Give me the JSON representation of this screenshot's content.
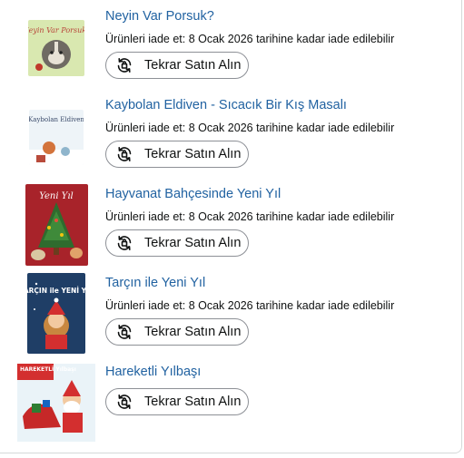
{
  "items": [
    {
      "title": "Neyin Var Porsuk?",
      "return_text": "Ürünleri iade et: 8 Ocak 2026 tarihine kadar iade edilebilir",
      "button_label": "Tekrar Satın Alın",
      "cover_text": "Neyin Var Porsuk?"
    },
    {
      "title": "Kaybolan Eldiven - Sıcacık Bir Kış Masalı",
      "return_text": "Ürünleri iade et: 8 Ocak 2026 tarihine kadar iade edilebilir",
      "button_label": "Tekrar Satın Alın",
      "cover_text": "Kaybolan Eldiven"
    },
    {
      "title": "Hayvanat Bahçesinde Yeni Yıl",
      "return_text": "Ürünleri iade et: 8 Ocak 2026 tarihine kadar iade edilebilir",
      "button_label": "Tekrar Satın Alın",
      "cover_text": "Yeni Yıl"
    },
    {
      "title": "Tarçın ile Yeni Yıl",
      "return_text": "Ürünleri iade et: 8 Ocak 2026 tarihine kadar iade edilebilir",
      "button_label": "Tekrar Satın Alın",
      "cover_text": "TARÇIN ile YENİ YIL"
    },
    {
      "title": "Hareketli Yılbaşı",
      "button_label": "Tekrar Satın Alın",
      "cover_text": "HAREKETLİ Yılbaşı"
    }
  ],
  "colors": {
    "link": "#2162a1",
    "text": "#0f1111",
    "button_border": "#8d9096",
    "panel_border": "#d5d9d9"
  },
  "icons": {
    "buy_again": "rebuy-icon"
  }
}
